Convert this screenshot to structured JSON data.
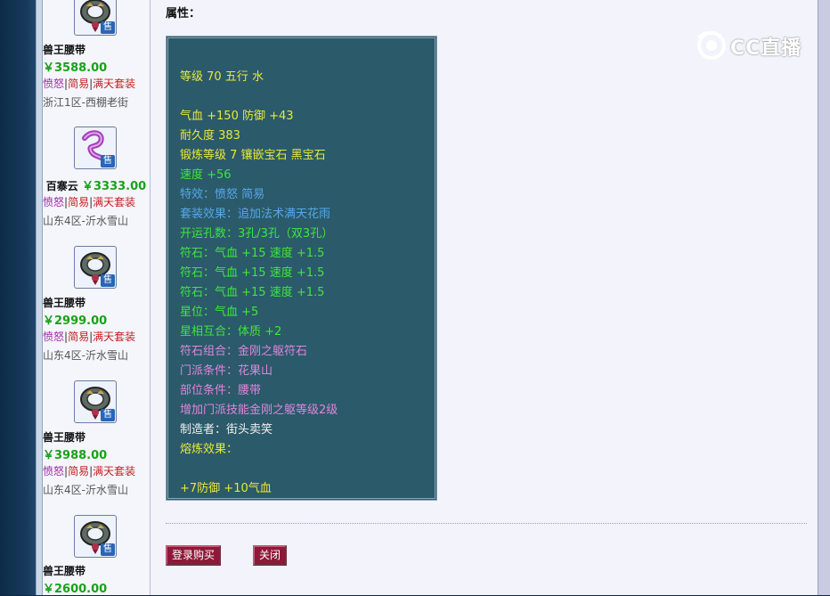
{
  "sidebar": {
    "items": [
      {
        "name": "兽王腰带",
        "price": "￥3588.00",
        "tag1": "愤怒",
        "tag2": "简易",
        "tag3": "满天套装",
        "server": "浙江1区-西棚老街",
        "icon": "belt-icon"
      },
      {
        "name": "百寨云",
        "price": "￥3333.00",
        "tag1": "愤怒",
        "tag2": "简易",
        "tag3": "满天套装",
        "server": "山东4区-沂水雪山",
        "icon": "cloud-belt-icon"
      },
      {
        "name": "兽王腰带",
        "price": "￥2999.00",
        "tag1": "愤怒",
        "tag2": "简易",
        "tag3": "满天套装",
        "server": "山东4区-沂水雪山",
        "icon": "belt-icon"
      },
      {
        "name": "兽王腰带",
        "price": "￥3988.00",
        "tag1": "愤怒",
        "tag2": "简易",
        "tag3": "满天套装",
        "server": "山东4区-沂水雪山",
        "icon": "belt-icon"
      },
      {
        "name": "兽王腰带",
        "price": "￥2600.00",
        "icon": "belt-icon"
      }
    ],
    "sell_badge": "售",
    "separator": "|"
  },
  "attributes": {
    "label": "属性：",
    "lines": [
      {
        "text": "等级 70 五行 水",
        "color": "#e8e83a"
      },
      {
        "text": "气血 +150 防御 +43",
        "color": "#e8e83a"
      },
      {
        "text": "耐久度 383",
        "color": "#e8e83a"
      },
      {
        "text": "锻炼等级 7 镶嵌宝石 黑宝石",
        "color": "#e8e83a"
      },
      {
        "text": "速度 +56",
        "color": "#3ee63e"
      },
      {
        "text": "特效：愤怒 简易",
        "color": "#55a8e8"
      },
      {
        "text": "套装效果：追加法术满天花雨",
        "color": "#55a8e8"
      },
      {
        "text": "开运孔数：3孔/3孔（双3孔）",
        "color": "#3ee63e"
      },
      {
        "text": "符石：气血 +15 速度 +1.5",
        "color": "#3ee63e"
      },
      {
        "text": "符石：气血 +15 速度 +1.5",
        "color": "#3ee63e"
      },
      {
        "text": "符石：气血 +15 速度 +1.5",
        "color": "#3ee63e"
      },
      {
        "text": "星位：气血 +5",
        "color": "#3ee63e"
      },
      {
        "text": "星相互合：体质 +2",
        "color": "#3ee63e"
      },
      {
        "text": "符石组合：金刚之躯符石",
        "color": "#dc86dc"
      },
      {
        "text": "门派条件：花果山",
        "color": "#dc86dc"
      },
      {
        "text": "部位条件：腰带",
        "color": "#dc86dc"
      },
      {
        "text": "增加门派技能金刚之躯等级2级",
        "color": "#dc86dc"
      },
      {
        "text": "制造者：街头卖笑",
        "color": "#f0f0f0"
      },
      {
        "text": "熔炼效果：",
        "color": "#e8e83a"
      },
      {
        "text": "+7防御 +10气血",
        "color": "#e8e83a"
      }
    ]
  },
  "buttons": {
    "buy": "登录购买",
    "close": "关闭"
  },
  "watermark": {
    "text": "CC直播"
  },
  "colors": {
    "panel_bg": "#2b5a6a",
    "button_bg": "#8e1838",
    "price_green": "#1aa11a"
  }
}
